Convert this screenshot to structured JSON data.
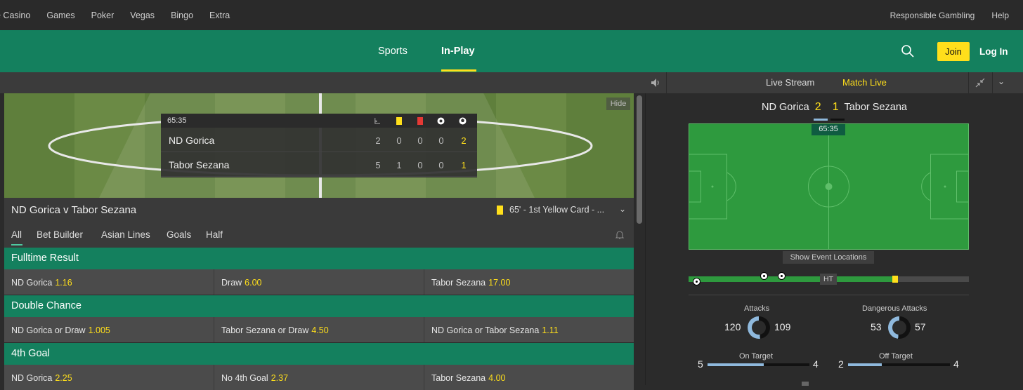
{
  "topbar": {
    "left_links": [
      "e Casino",
      "Games",
      "Poker",
      "Vegas",
      "Bingo",
      "Extra"
    ],
    "right_links": [
      "Responsible Gambling",
      "Help"
    ]
  },
  "nav": {
    "sports": "Sports",
    "inplay": "In-Play",
    "join": "Join",
    "login": "Log In"
  },
  "video": {
    "hide": "Hide"
  },
  "scoreboard": {
    "clock": "65:35",
    "columns": [
      "corners-icon",
      "yellow-card-icon",
      "red-card-icon",
      "penalty-icon",
      "goal-icon"
    ],
    "home": {
      "name": "ND Gorica",
      "stats": [
        "2",
        "0",
        "0",
        "0",
        "2"
      ]
    },
    "away": {
      "name": "Tabor Sezana",
      "stats": [
        "5",
        "1",
        "0",
        "0",
        "1"
      ]
    }
  },
  "match": {
    "title": "ND Gorica v Tabor Sezana",
    "last_event": "65' - 1st Yellow Card - ..."
  },
  "market_tabs": [
    "All",
    "Bet Builder",
    "Asian Lines",
    "Goals",
    "Half"
  ],
  "markets": [
    {
      "title": "Fulltime Result",
      "selections": [
        {
          "name": "ND Gorica",
          "odds": "1.16"
        },
        {
          "name": "Draw",
          "odds": "6.00"
        },
        {
          "name": "Tabor Sezana",
          "odds": "17.00"
        }
      ]
    },
    {
      "title": "Double Chance",
      "selections": [
        {
          "name": "ND Gorica or Draw",
          "odds": "1.005"
        },
        {
          "name": "Tabor Sezana or Draw",
          "odds": "4.50"
        },
        {
          "name": "ND Gorica or Tabor Sezana",
          "odds": "1.11"
        }
      ]
    },
    {
      "title": "4th Goal",
      "selections": [
        {
          "name": "ND Gorica",
          "odds": "2.25"
        },
        {
          "name": "No 4th Goal",
          "odds": "2.37"
        },
        {
          "name": "Tabor Sezana",
          "odds": "4.00"
        }
      ]
    }
  ],
  "right_panel": {
    "tabs": {
      "live_stream": "Live Stream",
      "match_live": "Match Live"
    },
    "home_name": "ND Gorica",
    "home_score": "2",
    "away_score": "1",
    "away_name": "Tabor Sezana",
    "clock": "65:35",
    "show_event_locations": "Show Event Locations",
    "timeline": {
      "ht_label": "HT",
      "progress_fraction": 0.73
    },
    "stats": {
      "attacks": {
        "label": "Attacks",
        "home": "120",
        "away": "109",
        "home_share": 0.52
      },
      "dangerous_attacks": {
        "label": "Dangerous Attacks",
        "home": "53",
        "away": "57",
        "home_share": 0.48
      },
      "on_target": {
        "label": "On Target",
        "home": "5",
        "away": "4",
        "home_share": 0.55
      },
      "off_target": {
        "label": "Off Target",
        "home": "2",
        "away": "4",
        "home_share": 0.33
      }
    }
  },
  "colors": {
    "brand_green": "#14805e",
    "accent_yellow": "#ffdf1b",
    "home_blue": "#8fb9dd"
  }
}
